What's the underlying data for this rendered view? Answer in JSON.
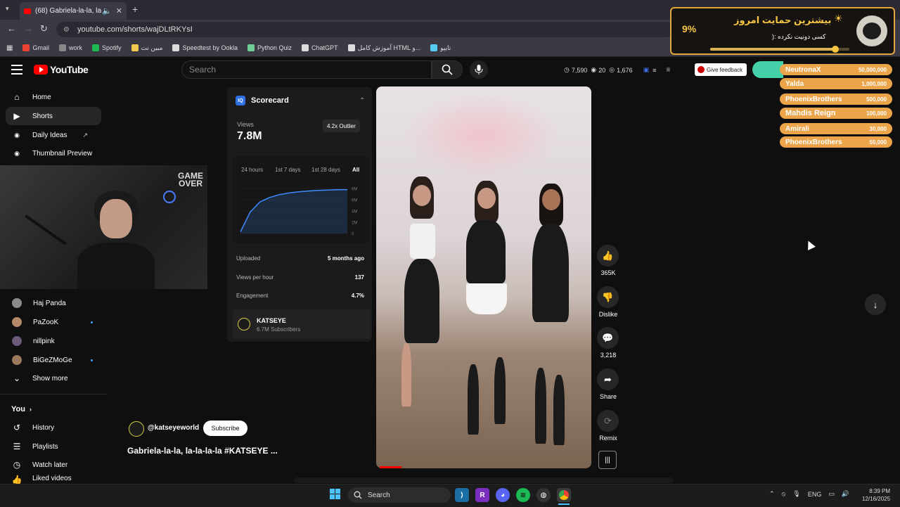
{
  "browser": {
    "tab_title": "(68) Gabriela-la-la, la-la-la-la",
    "url": "youtube.com/shorts/wajDLtRKYsI",
    "bookmarks": [
      {
        "label": "Gmail",
        "color": "#ea4335"
      },
      {
        "label": "work",
        "color": "#888888"
      },
      {
        "label": "Spotify",
        "color": "#1db954"
      },
      {
        "label": "مبین نت",
        "color": "#f2c94c"
      },
      {
        "label": "Speedtest by Ookla",
        "color": "#dddddd"
      },
      {
        "label": "Python Quiz",
        "color": "#6fcf97"
      },
      {
        "label": "ChatGPT",
        "color": "#dddddd"
      },
      {
        "label": "آموزش کامل HTML و...",
        "color": "#dddddd"
      },
      {
        "label": "تایپو",
        "color": "#56ccf2"
      }
    ]
  },
  "header": {
    "logo": "YouTube",
    "search_placeholder": "Search",
    "stats": [
      "7,590",
      "20",
      "1,676"
    ],
    "feedback": "Give feedback"
  },
  "sidebar": {
    "home": "Home",
    "shorts": "Shorts",
    "daily_ideas": "Daily Ideas",
    "thumbnail_preview": "Thumbnail Preview",
    "subscriptions": [
      {
        "name": "Haj Panda",
        "color": "#8a8a8a",
        "new": false
      },
      {
        "name": "PaZooK",
        "color": "#b58a6a",
        "new": true
      },
      {
        "name": "nillpink",
        "color": "#6b5a7a",
        "new": false
      },
      {
        "name": "BiGeZMoGe",
        "color": "#9a7a5a",
        "new": true
      }
    ],
    "show_more": "Show more",
    "you": "You",
    "history": "History",
    "playlists": "Playlists",
    "watch_later": "Watch later",
    "liked_videos": "Liked videos"
  },
  "webcam": {
    "overlay_text": "GAME OVER"
  },
  "scorecard": {
    "title": "Scorecard",
    "views_label": "Views",
    "views_value": "7.8M",
    "outlier": "4.2x Outlier",
    "timeframes": [
      "24 hours",
      "1st 7 days",
      "1st 28 days",
      "All"
    ],
    "rows": [
      {
        "label": "Uploaded",
        "value": "5 months ago"
      },
      {
        "label": "Views per hour",
        "value": "137"
      },
      {
        "label": "Engagement",
        "value": "4.7%"
      }
    ],
    "channel_name": "KATSEYE",
    "channel_subs": "6.7M Subscribers"
  },
  "chart_data": {
    "type": "area",
    "title": "",
    "xlabel": "",
    "ylabel": "",
    "ylim": [
      0,
      8
    ],
    "y_ticks": [
      "8M",
      "6M",
      "4M",
      "2M",
      "0"
    ],
    "series": [
      {
        "values": [
          0.3,
          3.8,
          5.6,
          6.4,
          6.9,
          7.2,
          7.4,
          7.55,
          7.65,
          7.72,
          7.78,
          7.8
        ]
      }
    ]
  },
  "actions": {
    "like": "365K",
    "dislike": "Dislike",
    "comments": "3,218",
    "share": "Share",
    "remix": "Remix"
  },
  "video": {
    "owner_handle": "@katseyeworld",
    "subscribe": "Subscribe",
    "title": "Gabriela-la-la, la-la-la-la #KATSEYE ...",
    "progress": 0.1
  },
  "donation": {
    "percent": "9%",
    "title": "بیشترین حمایت امروز",
    "subtitle": "کسی دونیت نکرده :(",
    "progress": 0.9,
    "leaderboard": [
      {
        "name": "NeutronaX",
        "amount": "50,000,000"
      },
      {
        "name": "Yalda",
        "amount": "1,000,000"
      },
      {
        "name": "PhoenixBrothers",
        "amount": "500,000"
      },
      {
        "name": "Mahdis Reign",
        "amount": "100,000"
      },
      {
        "name": "Amirali",
        "amount": "30,000"
      },
      {
        "name": "PhoenixBrothers",
        "amount": "50,000"
      }
    ]
  },
  "taskbar": {
    "search": "Search",
    "lang": "ENG",
    "time": "8:39 PM",
    "date": "12/16/2025"
  },
  "colors": {
    "accent": "#ff0000",
    "link": "#3ea6ff",
    "chart": "#3e8cff",
    "donation": "#eca44a"
  }
}
